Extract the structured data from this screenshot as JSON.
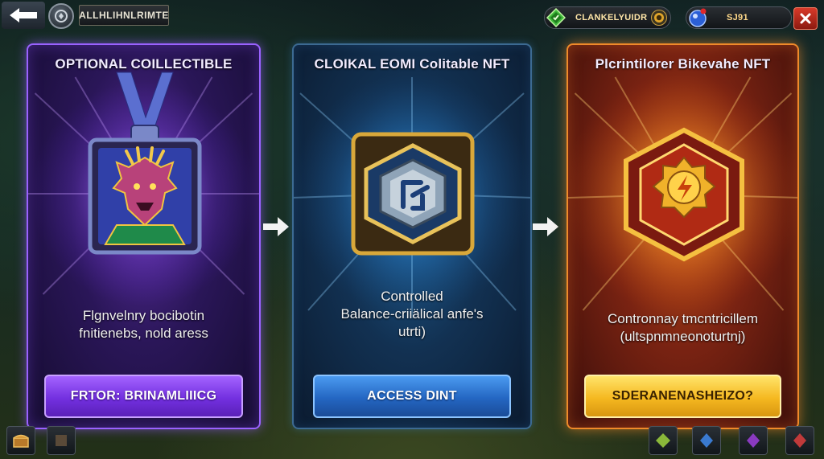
{
  "header": {
    "title": "ALLHLIHNLRIMTE",
    "currency_left": "CLANKELYUIDR",
    "currency_right": "SJ91"
  },
  "cards": [
    {
      "title": "OPTIONAL COILLECTIBLE",
      "desc_line1": "Flgnvelnry bocibotin",
      "desc_line2": "fnitienebs, nold aress",
      "button": "FRTOR: BRINAMLIIICG",
      "accent": "#9a62ff"
    },
    {
      "title": "CLOIKAL EOMI Colitable NFT",
      "desc_line1": "Controlled",
      "desc_line2": "Balance-criiälical anfe's",
      "desc_line3": "utrti)",
      "button": "ACCESS DINT",
      "accent": "#3c6a92"
    },
    {
      "title": "Plcrintilorer Bikevahe NFT",
      "desc_line1": "Contronnay tmcntricillem",
      "desc_line2": "(ultspnmneonoturtnj)",
      "button": "SDERANENASHEIZO?",
      "accent": "#f08a2a"
    }
  ],
  "icons": {
    "back": "back-arrow-icon",
    "profile": "profile-badge-icon",
    "gem": "green-gem-icon",
    "coin": "gold-coin-icon",
    "blue_orb": "blue-orb-icon",
    "close": "close-icon",
    "flow": "flow-arrow-icon"
  }
}
